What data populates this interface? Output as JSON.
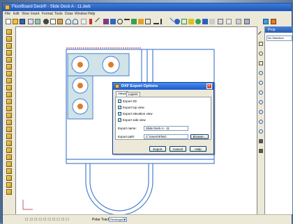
{
  "app": {
    "title": "FloorBoard Deck® - Slide Deck A - 11.dwb",
    "menu": [
      "File",
      "Edit",
      "View",
      "Insert",
      "Format",
      "Tools",
      "Draw",
      "Window",
      "Help"
    ]
  },
  "status": {
    "icons_text": "☐ ☐ ☐ ☐ ☐ ☐ ☐ ☐ ☐ ☐",
    "snap_label": "Polar Tracking",
    "snap_value": "Rectangular"
  },
  "panel": {
    "title": "Prop",
    "selection": "No Selection"
  },
  "dialog": {
    "title": "DXF Export Options",
    "tabs": [
      "Views",
      "Layers"
    ],
    "checkboxes": [
      {
        "label": "Export 2D",
        "checked": true
      },
      {
        "label": "Export top view",
        "checked": true
      },
      {
        "label": "Export elevation view",
        "checked": true
      },
      {
        "label": "Export side view",
        "checked": true
      }
    ],
    "export_name_label": "Export name:",
    "export_name_value": "Slide Deck A - 11",
    "export_path_label": "Export path:",
    "export_path_value": "C:\\Users\\Files\\",
    "browse_label": "Browse...",
    "buttons": {
      "export": "Export",
      "cancel": "Cancel",
      "help": "Help"
    },
    "check_mark": "✓",
    "close_glyph": "×"
  },
  "colors": {
    "plan_line": "#4a7fd0",
    "fixture_fill": "#cfe3e8",
    "fixture_accent": "#e07a2a",
    "hatch": "#d07070"
  },
  "combo_arrow": "▾"
}
